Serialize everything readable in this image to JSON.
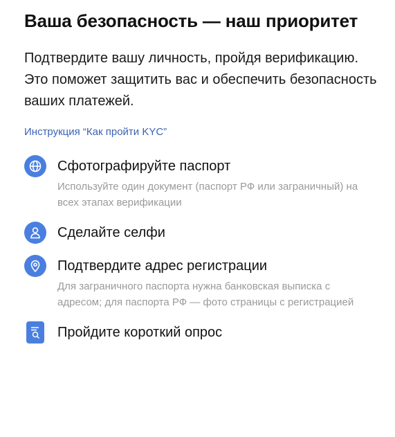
{
  "heading": {
    "title": "Ваша безопасность — наш приоритет",
    "subtitle": "Подтвердите вашу личность, пройдя верификацию. Это поможет защитить вас и обеспечить безопасность ваших платежей."
  },
  "link": {
    "label": "Инструкция “Как пройти KYC”"
  },
  "colors": {
    "accent": "#4a7fe0",
    "link": "#3b63b5",
    "muted_text": "#9a9a9a"
  },
  "steps": [
    {
      "icon": "globe-icon",
      "title": "Сфотографируйте паспорт",
      "description": "Используйте один документ (паспорт РФ или заграничный) на всех этапах верификации"
    },
    {
      "icon": "user-icon",
      "title": "Сделайте селфи",
      "description": ""
    },
    {
      "icon": "location-pin-icon",
      "title": "Подтвердите адрес регистрации",
      "description": "Для заграничного паспорта нужна банковская выписка с адресом; для паспорта РФ — фото страницы с регистрацией"
    },
    {
      "icon": "document-search-icon",
      "title": "Пройдите короткий опрос",
      "description": ""
    }
  ]
}
